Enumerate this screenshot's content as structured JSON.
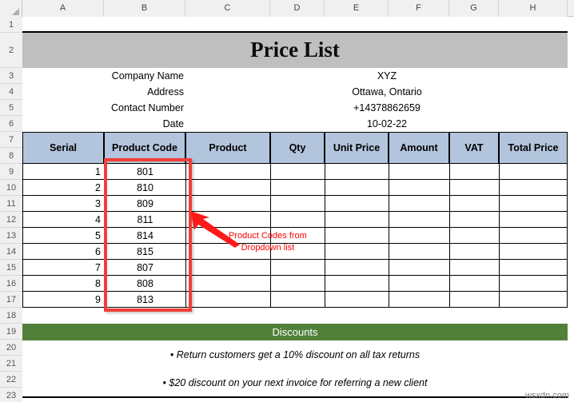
{
  "spreadsheet": {
    "column_headers": [
      "A",
      "B",
      "C",
      "D",
      "E",
      "F",
      "G",
      "H"
    ],
    "row_numbers": [
      "1",
      "2",
      "3",
      "4",
      "5",
      "6",
      "7",
      "8",
      "9",
      "10",
      "11",
      "12",
      "13",
      "14",
      "15",
      "16",
      "17",
      "18",
      "19",
      "20",
      "21",
      "22",
      "23"
    ],
    "watermark": "wsxdn.com"
  },
  "title": "Price List",
  "info": [
    {
      "label": "Company Name",
      "value": "XYZ"
    },
    {
      "label": "Address",
      "value": "Ottawa, Ontario"
    },
    {
      "label": "Contact Number",
      "value": "+14378862659"
    },
    {
      "label": "Date",
      "value": "10-02-22"
    }
  ],
  "table": {
    "headers": [
      "Serial",
      "Product Code",
      "Product",
      "Qty",
      "Unit Price",
      "Amount",
      "VAT",
      "Total Price"
    ],
    "rows": [
      {
        "serial": "1",
        "product_code": "801",
        "product": "",
        "qty": "",
        "unit_price": "",
        "amount": "",
        "vat": "",
        "total_price": ""
      },
      {
        "serial": "2",
        "product_code": "810",
        "product": "",
        "qty": "",
        "unit_price": "",
        "amount": "",
        "vat": "",
        "total_price": ""
      },
      {
        "serial": "3",
        "product_code": "809",
        "product": "",
        "qty": "",
        "unit_price": "",
        "amount": "",
        "vat": "",
        "total_price": ""
      },
      {
        "serial": "4",
        "product_code": "811",
        "product": "",
        "qty": "",
        "unit_price": "",
        "amount": "",
        "vat": "",
        "total_price": ""
      },
      {
        "serial": "5",
        "product_code": "814",
        "product": "",
        "qty": "",
        "unit_price": "",
        "amount": "",
        "vat": "",
        "total_price": ""
      },
      {
        "serial": "6",
        "product_code": "815",
        "product": "",
        "qty": "",
        "unit_price": "",
        "amount": "",
        "vat": "",
        "total_price": ""
      },
      {
        "serial": "7",
        "product_code": "807",
        "product": "",
        "qty": "",
        "unit_price": "",
        "amount": "",
        "vat": "",
        "total_price": ""
      },
      {
        "serial": "8",
        "product_code": "808",
        "product": "",
        "qty": "",
        "unit_price": "",
        "amount": "",
        "vat": "",
        "total_price": ""
      },
      {
        "serial": "9",
        "product_code": "813",
        "product": "",
        "qty": "",
        "unit_price": "",
        "amount": "",
        "vat": "",
        "total_price": ""
      }
    ]
  },
  "discounts": {
    "heading": "Discounts",
    "lines": [
      "• Return customers get a 10% discount on all tax returns",
      "• $20 discount on your next invoice for referring a new client"
    ]
  },
  "annotation": {
    "line1": "Product Codes from",
    "line2": "Dropdown list"
  },
  "colors": {
    "title_band": "#bfbfbf",
    "table_header": "#b3c5dc",
    "discount_header": "#51803a",
    "callout": "#ff0000",
    "callout_box": "#f03e36"
  }
}
